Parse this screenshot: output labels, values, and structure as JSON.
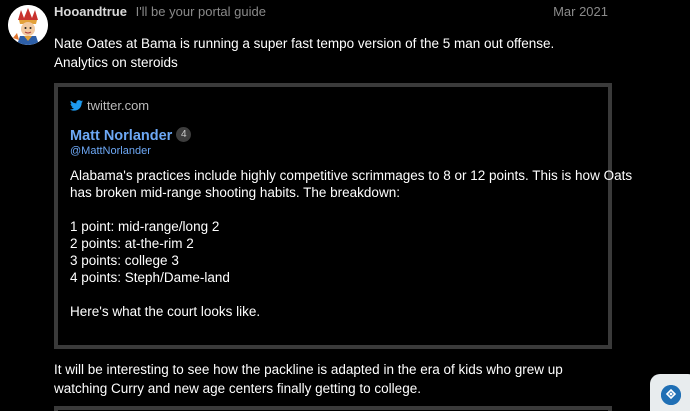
{
  "post": {
    "username": "Hooandtrue",
    "user_title": "I'll be your portal guide",
    "date": "Mar 2021",
    "avatar_icon": "cartoon-character-avatar",
    "paragraph_1": "Nate Oates at Bama is running a super fast tempo version of the 5 man out offense. Analytics on steroids",
    "paragraph_2": "It will be interesting to see how the packline is adapted in the era of kids who grew up watching Curry and new age centers finally getting to college."
  },
  "onebox": {
    "source_icon": "twitter-bird-icon",
    "source": "twitter.com",
    "author_name": "Matt Norlander",
    "badge_count": "4",
    "handle": "@MattNorlander",
    "body_lines": [
      "Alabama's practices include highly competitive scrimmages to 8 or 12 points. This is how Oats",
      "has broken mid-range shooting habits. The breakdown:"
    ],
    "points": [
      "1 point: mid-range/long 2",
      "2 points: at-the-rim 2",
      "3 points: college 3",
      "4 points: Steph/Dame-land"
    ],
    "closing": "Here's what the court looks like."
  },
  "widget": {
    "icon": "chat-support-icon"
  },
  "colors": {
    "background": "#000000",
    "link": "#6da8f5",
    "border": "#3a3a3a",
    "muted": "#8a8a8a"
  }
}
